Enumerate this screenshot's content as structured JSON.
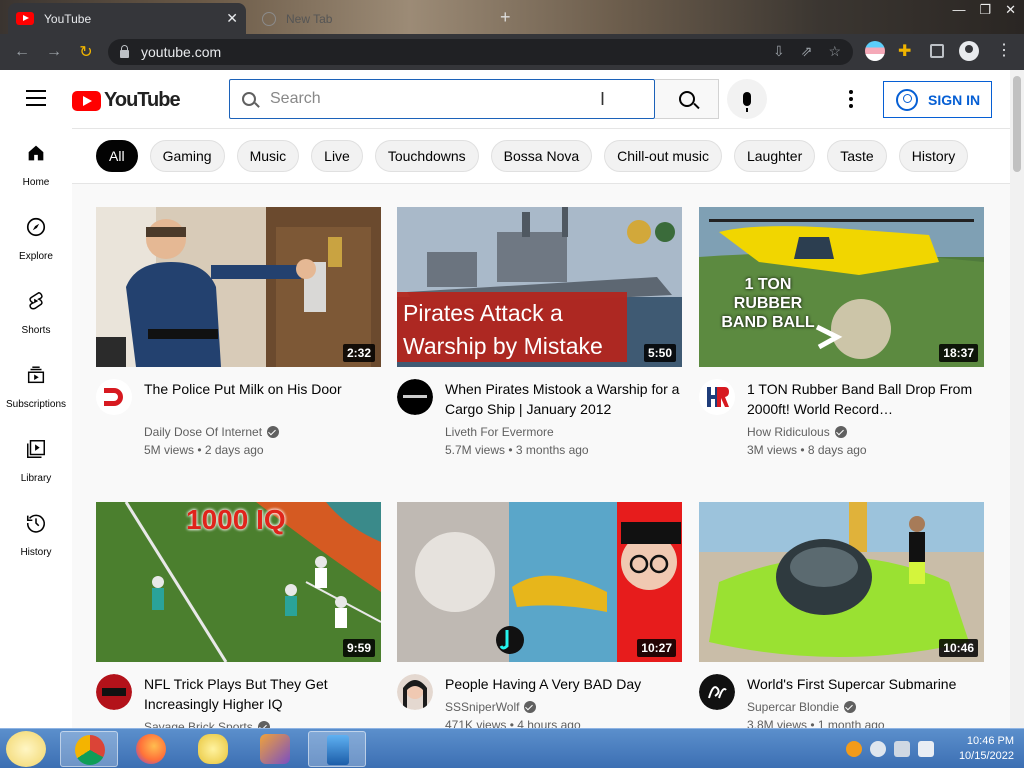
{
  "browser": {
    "tabs": [
      {
        "title": "YouTube"
      },
      {
        "title": "New Tab"
      }
    ],
    "url": "youtube.com"
  },
  "masthead": {
    "logo_text": "YouTube",
    "search_placeholder": "Search",
    "signin_label": "SIGN IN"
  },
  "sidebar": {
    "items": [
      {
        "label": "Home"
      },
      {
        "label": "Explore"
      },
      {
        "label": "Shorts"
      },
      {
        "label": "Subscriptions"
      },
      {
        "label": "Library"
      },
      {
        "label": "History"
      }
    ]
  },
  "chips": [
    "All",
    "Gaming",
    "Music",
    "Live",
    "Touchdowns",
    "Bossa Nova",
    "Chill-out music",
    "Laughter",
    "Taste",
    "History"
  ],
  "videos": [
    {
      "title": "The Police Put Milk on His Door",
      "channel": "Daily Dose Of Internet",
      "stats": "5M views • 2 days ago",
      "duration": "2:32"
    },
    {
      "title": "When Pirates Mistook a Warship for a Cargo Ship | January 2012",
      "channel": "Liveth For Evermore",
      "stats": "5.7M views • 3 months ago",
      "duration": "5:50",
      "thumb_text": "Pirates Attack a Warship by Mistake"
    },
    {
      "title": "1 TON Rubber Band Ball Drop From 2000ft! World Record…",
      "channel": "How Ridiculous",
      "stats": "3M views • 8 days ago",
      "duration": "18:37",
      "thumb_text": "1 TON RUBBER BAND BALL"
    },
    {
      "title": "NFL Trick Plays But They Get Increasingly Higher IQ",
      "channel": "Savage Brick Sports",
      "stats": "",
      "duration": "9:59",
      "thumb_text": "1000 IQ"
    },
    {
      "title": "People Having A Very BAD Day",
      "channel": "SSSniperWolf",
      "stats": "471K views • 4 hours ago",
      "duration": "10:27"
    },
    {
      "title": "World's First Supercar Submarine",
      "channel": "Supercar Blondie",
      "stats": "3.8M views • 1 month ago",
      "duration": "10:46"
    }
  ],
  "taskbar": {
    "time": "10:46 PM",
    "date": "10/15/2022"
  },
  "colors": {
    "yt_red": "#ff0000",
    "signin_blue": "#065fd4",
    "chrome_dark": "#35363a"
  }
}
